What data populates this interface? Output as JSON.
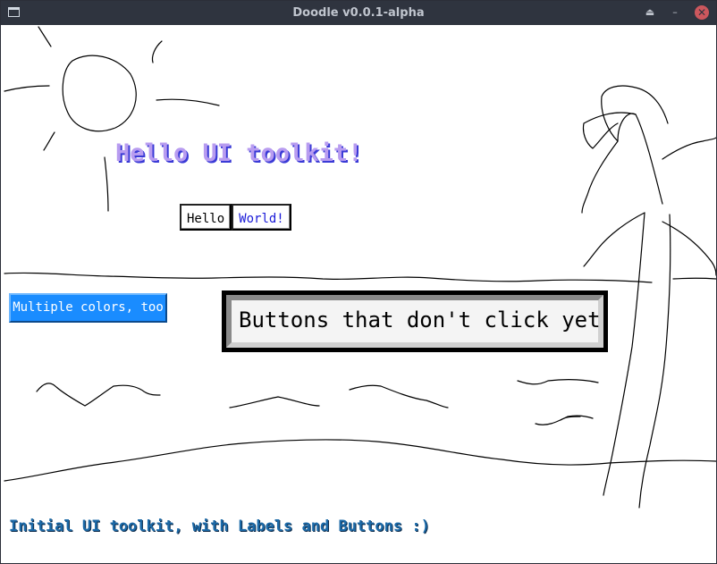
{
  "window": {
    "title": "Doodle v0.0.1-alpha",
    "buttons": {
      "shade": "⏏",
      "minimize": "–",
      "close": "✕"
    }
  },
  "labels": {
    "hello_title": "Hello UI toolkit!",
    "footer": "Initial UI toolkit, with Labels and Buttons :)"
  },
  "buttons": {
    "hello": "Hello",
    "world": "World!",
    "colors": "Multiple colors, too",
    "big": "Buttons that don't click yet"
  },
  "colors": {
    "titlebar_bg": "#2f343f",
    "hello_title_fill": "#b89cf0",
    "hello_title_shadow": "#3a3ad6",
    "world_text": "#1a1ad8",
    "colors_button_bg": "#1a8cff",
    "footer_text": "#1c6aa8"
  }
}
